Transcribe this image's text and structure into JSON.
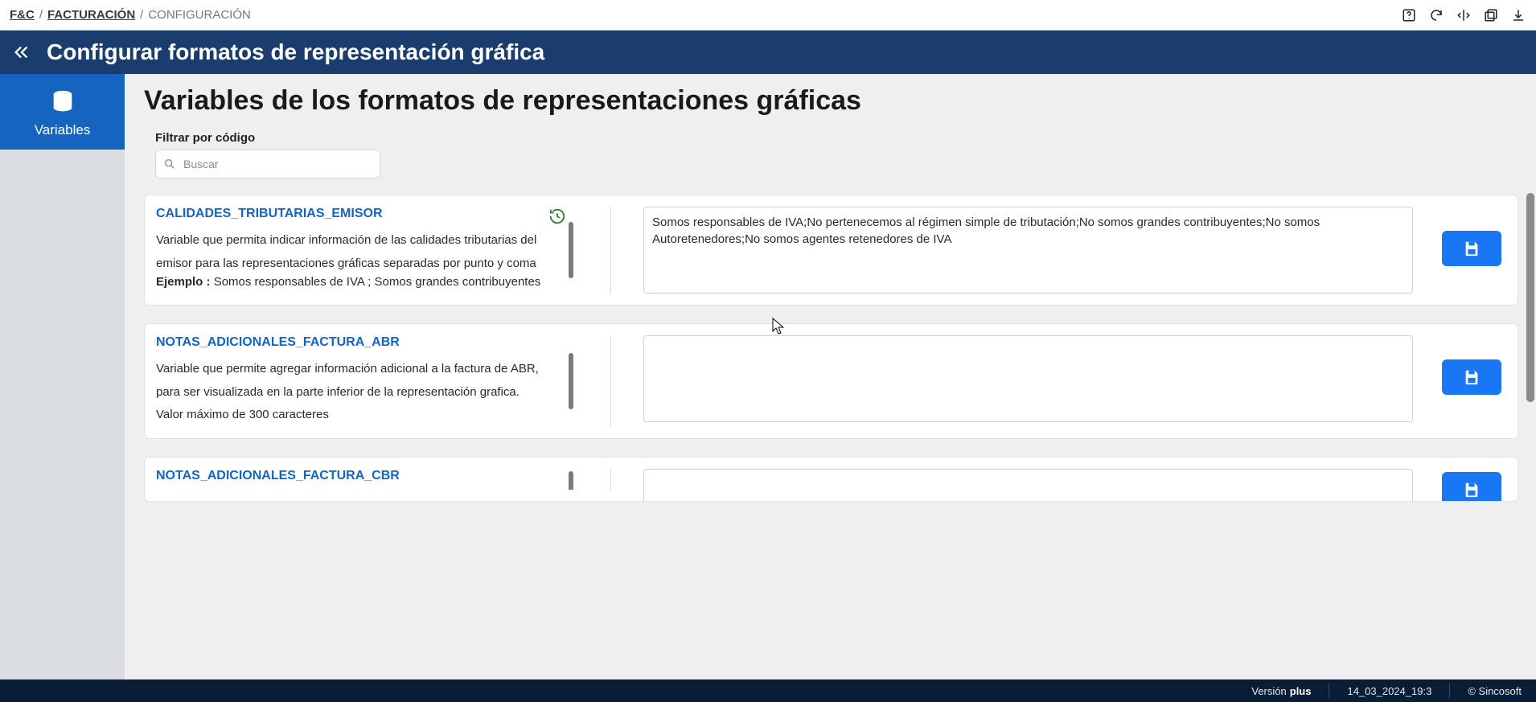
{
  "breadcrumb": {
    "item1": "F&C",
    "item2": "FACTURACIÓN",
    "item3": "CONFIGURACIÓN"
  },
  "header": {
    "title": "Configurar formatos de representación gráfica"
  },
  "sidebar": {
    "items": [
      {
        "label": "Variables"
      }
    ]
  },
  "page": {
    "title": "Variables de los formatos de representaciones gráficas",
    "filter_label": "Filtrar por código",
    "search_placeholder": "Buscar"
  },
  "cards": [
    {
      "code": "CALIDADES_TRIBUTARIAS_EMISOR",
      "description": "Variable que permita indicar información de las calidades tributarias del emisor para las representaciones gráficas separadas por punto y coma",
      "example_label": "Ejemplo : ",
      "example_text": "Somos responsables de IVA ; Somos grandes contribuyentes",
      "value": "Somos responsables de IVA;No pertenecemos al régimen simple de tributación;No somos grandes contribuyentes;No somos Autoretenedores;No somos agentes retenedores de IVA",
      "has_history": true
    },
    {
      "code": "NOTAS_ADICIONALES_FACTURA_ABR",
      "description": "Variable que permite agregar información adicional a la factura de ABR, para ser visualizada en la parte inferior de la representación grafica.",
      "desc2": "Valor máximo de 300 caracteres",
      "value": "",
      "has_history": false
    },
    {
      "code": "NOTAS_ADICIONALES_FACTURA_CBR",
      "description": "",
      "value": "",
      "has_history": false
    }
  ],
  "footer": {
    "version_label": "Versión",
    "version_value": "plus",
    "build": "14_03_2024_19:3",
    "copyright": "© Sincosoft"
  }
}
